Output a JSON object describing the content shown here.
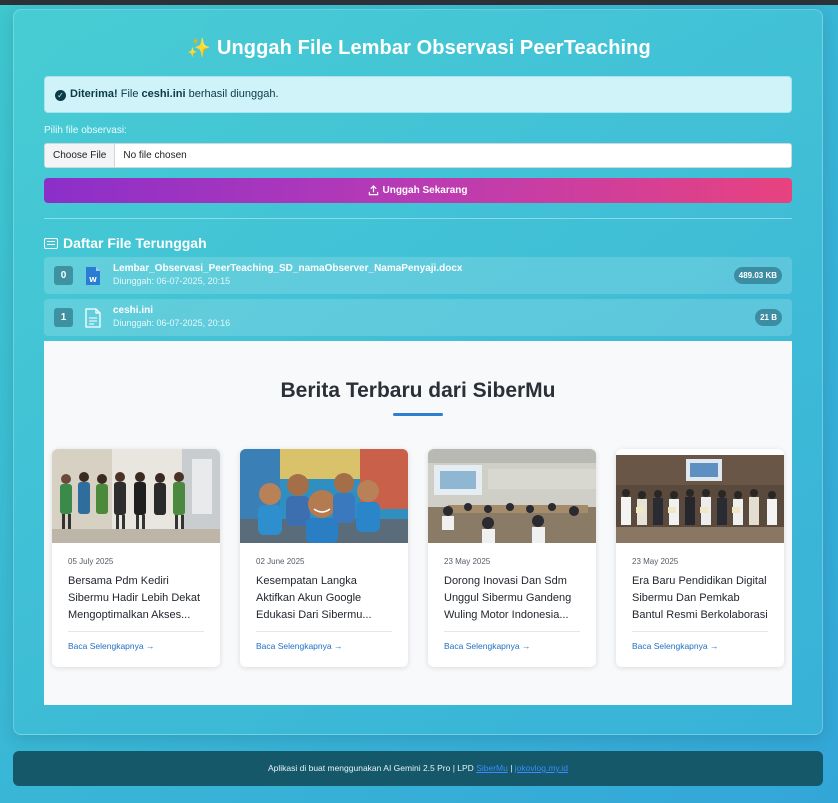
{
  "page": {
    "title": "Unggah File Lembar Observasi PeerTeaching",
    "title_icon": "sparkle-icon"
  },
  "alert": {
    "strong": "Diterima!",
    "prefix": " File ",
    "filename": "ceshi.ini",
    "suffix": " berhasil diunggah.",
    "icon": "check-circle-icon"
  },
  "upload_form": {
    "label": "Pilih file observasi:",
    "choose_button": "Choose File",
    "chosen_text": "No file chosen",
    "submit_label": "Unggah Sekarang",
    "submit_icon": "upload-icon"
  },
  "file_list": {
    "heading": "Daftar File Terunggah",
    "heading_icon": "list-icon",
    "files": [
      {
        "index": "0",
        "name": "Lembar_Observasi_PeerTeaching_SD_namaObserver_NamaPenyaji.docx",
        "date": "Diunggah: 06-07-2025, 20:15",
        "size": "489.03 KB",
        "icon": "word-file-icon"
      },
      {
        "index": "1",
        "name": "ceshi.ini",
        "date": "Diunggah: 06-07-2025, 20:16",
        "size": "21 B",
        "icon": "text-file-icon"
      }
    ]
  },
  "news": {
    "title": "Berita Terbaru dari SiberMu",
    "read_more": "Baca Selengkapnya →",
    "articles": [
      {
        "date": "05 July 2025",
        "title": "Bersama Pdm Kediri Sibermu Hadir Lebih Dekat Mengoptimalkan Akses..."
      },
      {
        "date": "02 June 2025",
        "title": "Kesempatan Langka Aktifkan Akun Google Edukasi Dari Sibermu..."
      },
      {
        "date": "23 May 2025",
        "title": "Dorong Inovasi Dan Sdm Unggul Sibermu Gandeng Wuling Motor Indonesia..."
      },
      {
        "date": "23 May 2025",
        "title": "Era Baru Pendidikan Digital Sibermu Dan Pemkab Bantul Resmi Berkolaborasi"
      }
    ]
  },
  "footer": {
    "text": "Aplikasi di buat menggunakan AI Gemini 2.5 Pro | LPD ",
    "link1": "SiberMu",
    "separator": " | ",
    "link2": "jokovlog.my.id"
  },
  "colors": {
    "accent_gradient_start": "#8b2fc9",
    "accent_gradient_end": "#e8427f",
    "link": "#1f6fc4",
    "alert_bg": "#cff3f9"
  }
}
